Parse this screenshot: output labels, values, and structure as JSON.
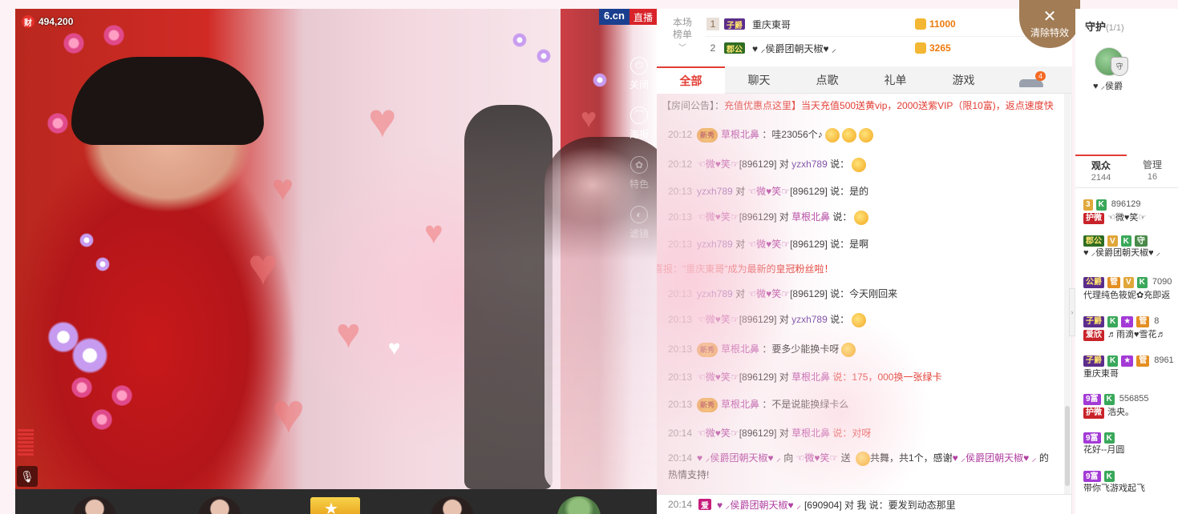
{
  "stream": {
    "coin_icon": "财",
    "coin_count": "494,200",
    "site_logo": "6.cn",
    "live_badge": "直播",
    "tools": [
      {
        "label": "关闭",
        "icon": "power-icon"
      },
      {
        "label": "海报",
        "icon": "poster-icon"
      },
      {
        "label": "特色",
        "icon": "effects-icon"
      },
      {
        "label": "滤镜",
        "icon": "filter-icon"
      }
    ]
  },
  "rank": {
    "label_line1": "本场",
    "label_line2": "榜单",
    "rows": [
      {
        "rank": "1",
        "badge": "子爵",
        "name": "重庆東哥",
        "score": "11000"
      },
      {
        "rank": "2",
        "badge": "郡公",
        "name": "♥ ⸝侯爵团朝天椒♥ ⸝",
        "score": "3265"
      }
    ]
  },
  "clear_effects": "清除特效",
  "tabs": [
    "全部",
    "聊天",
    "点歌",
    "礼单",
    "游戏"
  ],
  "car_count": "4",
  "chat": {
    "notice_label": "【房间公告】：",
    "notice_text": "充值优惠点这里】当天充值500送黄vip，2000送紫VIP（限10富)，返点速度快",
    "messages": [
      {
        "time": "20:12",
        "parts": [
          "草根北鼻",
          "：哇23056个♪"
        ]
      },
      {
        "time": "20:12",
        "parts": [
          "☜微♥笑☞",
          "[896129] 对",
          "yzxh789",
          " 说："
        ]
      },
      {
        "time": "20:13",
        "parts": [
          "yzxh789",
          " 对 ",
          "☜微♥笑☞",
          "[896129] 说：是的"
        ]
      },
      {
        "time": "20:13",
        "parts": [
          "☜微♥笑☞",
          "[896129] 对 ",
          "草根北鼻",
          " 说："
        ]
      },
      {
        "time": "20:13",
        "parts": [
          "yzxh789",
          " 对 ",
          "☜微♥笑☞",
          "[896129] 说：是啊"
        ]
      },
      {
        "time": "",
        "parts": [
          "喜报：\"重庆東哥\"成为最新的皇冠粉丝啦！"
        ]
      },
      {
        "time": "20:13",
        "parts": [
          "yzxh789",
          " 对 ",
          "☜微♥笑☞",
          "[896129] 说：今天刚回来"
        ]
      },
      {
        "time": "20:13",
        "parts": [
          "☜微♥笑☞",
          "[896129] 对 ",
          "yzxh789",
          " 说："
        ]
      },
      {
        "time": "20:13",
        "parts": [
          "草根北鼻",
          "：要多少能换卡呀"
        ]
      },
      {
        "time": "20:13",
        "parts": [
          "☜微♥笑☞",
          "[896129] 对 ",
          "草根北鼻",
          " 说：175，000换一张绿卡"
        ]
      },
      {
        "time": "20:13",
        "parts": [
          "草根北鼻",
          "：不是说能换绿卡么"
        ]
      },
      {
        "time": "20:14",
        "parts": [
          "☜微♥笑☞",
          "[896129] 对 ",
          "草根北鼻",
          " 说：对呀"
        ]
      },
      {
        "time": "20:14",
        "parts": [
          "♥ ⸝侯爵团朝天椒♥ ⸝",
          " 向 ",
          "☜微♥笑☞",
          " 送 ",
          "共舞，共1个，感谢",
          "♥ ⸝侯爵团朝天椒♥ ⸝",
          " 的"
        ]
      },
      {
        "time": "",
        "parts": [
          "热情支持!"
        ]
      }
    ],
    "bottom": {
      "time": "20:14",
      "badge": "爱",
      "user": "♥ ⸝侯爵团朝天椒♥ ⸝",
      "text": "[690904] 对 我 说：要发到动态那里"
    }
  },
  "right": {
    "guard_title": "守护",
    "guard_count": "(1/1)",
    "guard_shield": "守",
    "guard_name": "♥ ⸝侯爵",
    "aud_tabs": [
      {
        "label": "观众",
        "count": "2144"
      },
      {
        "label": "管理",
        "count": "16"
      }
    ],
    "audience": [
      {
        "line1_badges": [
          "3",
          "K"
        ],
        "line1_text": "896129",
        "line2_badge": "护微",
        "line2_text": "☜微♥笑☞"
      },
      {
        "line1_badges": [
          "郡公",
          "V",
          "K",
          "守"
        ],
        "line1_text": "",
        "line2_badge": "",
        "line2_text": "♥ ⸝侯爵团朝天椒♥ ⸝"
      },
      {
        "line1_badges": [
          "公爵",
          "管",
          "V",
          "K"
        ],
        "line1_text": "7090",
        "line2_badge": "",
        "line2_text": "代理纯色筱妮✿充即返"
      },
      {
        "line1_badges": [
          "子爵",
          "K",
          "★",
          "管"
        ],
        "line1_text": "8",
        "line2_badge": "爱欣",
        "line2_text": "♬雨滴♥雪花♬"
      },
      {
        "line1_badges": [
          "子爵",
          "K",
          "★",
          "管"
        ],
        "line1_text": "8961",
        "line2_badge": "",
        "line2_text": "重庆東哥"
      },
      {
        "line1_badges": [
          "9富",
          "K"
        ],
        "line1_text": "556855",
        "line2_badge": "护微",
        "line2_text": "浩央。"
      },
      {
        "line1_badges": [
          "9富",
          "K"
        ],
        "line1_text": "",
        "line2_badge": "",
        "line2_text": "花好--月圆"
      },
      {
        "line1_badges": [
          "9富",
          "K"
        ],
        "line1_text": "",
        "line2_badge": "",
        "line2_text": "带你飞游戏起飞"
      }
    ]
  }
}
